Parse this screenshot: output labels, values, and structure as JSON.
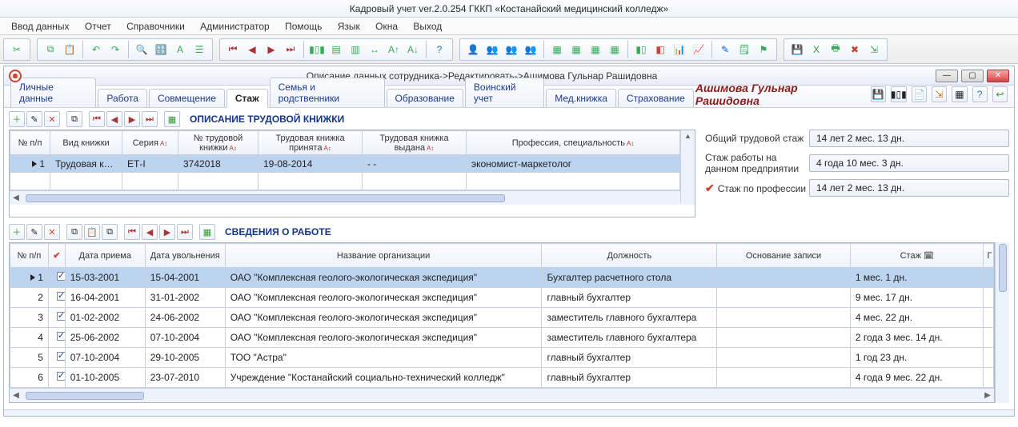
{
  "app_title": "Кадровый учет ver.2.0.254 ГККП «Костанайский медицинский колледж»",
  "menu": [
    "Ввод данных",
    "Отчет",
    "Справочники",
    "Администратор",
    "Помощь",
    "Язык",
    "Окна",
    "Выход"
  ],
  "subwindow": {
    "title": "Описание данных сотрудника->Редактировать->Ашимова Гульнар Рашидовна"
  },
  "tabs": [
    "Личные данные",
    "Работа",
    "Совмещение",
    "Стаж",
    "Семья и родственники",
    "Образование",
    "Воинский учет",
    "Мед.книжка",
    "Страхование"
  ],
  "active_tab": 3,
  "employee_name": "Ашимова Гульнар Рашидовна",
  "workbook": {
    "title": "ОПИСАНИЕ ТРУДОВОЙ КНИЖКИ",
    "columns": [
      "№ п/п",
      "Вид книжки",
      "Серия",
      "№ трудовой книжки",
      "Трудовая книжка принята",
      "Трудовая книжка выдана",
      "Профессия, специальность"
    ],
    "rows": [
      {
        "n": "1",
        "kind": "Трудовая книж",
        "series": "ЕТ-І",
        "number": "3742018",
        "accepted": "19-08-2014",
        "issued": "-  -",
        "prof": "экономист-маркетолог"
      }
    ]
  },
  "summary": {
    "total_label": "Общий трудовой стаж",
    "total_value": "14 лет 2 мес. 13 дн.",
    "here_label": "Стаж работы на данном предприятии",
    "here_value": "4 года 10 мес. 3 дн.",
    "prof_label": "Стаж по профессии",
    "prof_value": "14 лет 2 мес. 13 дн."
  },
  "jobs": {
    "title": "СВЕДЕНИЯ О РАБОТЕ",
    "columns": [
      "№ п/п",
      "",
      "Дата приема",
      "Дата увольнения",
      "Название организации",
      "Должность",
      "Основание записи",
      "Стаж"
    ],
    "rows": [
      {
        "n": "1",
        "chk": true,
        "hired": "15-03-2001",
        "fired": "15-04-2001",
        "org": "ОАО \"Комплексная геолого-экологическая экспедиция\"",
        "pos": "Бухгалтер расчетного стола",
        "basis": "",
        "stage": "1 мес. 1 дн."
      },
      {
        "n": "2",
        "chk": true,
        "hired": "16-04-2001",
        "fired": "31-01-2002",
        "org": "ОАО \"Комплексная геолого-экологическая экспедиция\"",
        "pos": "главный бухгалтер",
        "basis": "",
        "stage": "9 мес. 17 дн."
      },
      {
        "n": "3",
        "chk": true,
        "hired": "01-02-2002",
        "fired": "24-06-2002",
        "org": "ОАО \"Комплексная геолого-экологическая экспедиция\"",
        "pos": "заместитель главного бухгалтера",
        "basis": "",
        "stage": "4 мес. 22 дн."
      },
      {
        "n": "4",
        "chk": true,
        "hired": "25-06-2002",
        "fired": "07-10-2004",
        "org": "ОАО \"Комплексная геолого-экологическая экспедиция\"",
        "pos": "заместитель главного бухгалтера",
        "basis": "",
        "stage": "2 года 3 мес. 14 дн."
      },
      {
        "n": "5",
        "chk": true,
        "hired": "07-10-2004",
        "fired": "29-10-2005",
        "org": "ТОО \"Астра\"",
        "pos": "главный бухгалтер",
        "basis": "",
        "stage": "1 год 23 дн."
      },
      {
        "n": "6",
        "chk": true,
        "hired": "01-10-2005",
        "fired": "23-07-2010",
        "org": "Учреждение \"Костанайский социально-технический колледж\"",
        "pos": "главный бухгалтер",
        "basis": "",
        "stage": "4 года 9 мес. 22 дн."
      }
    ]
  }
}
